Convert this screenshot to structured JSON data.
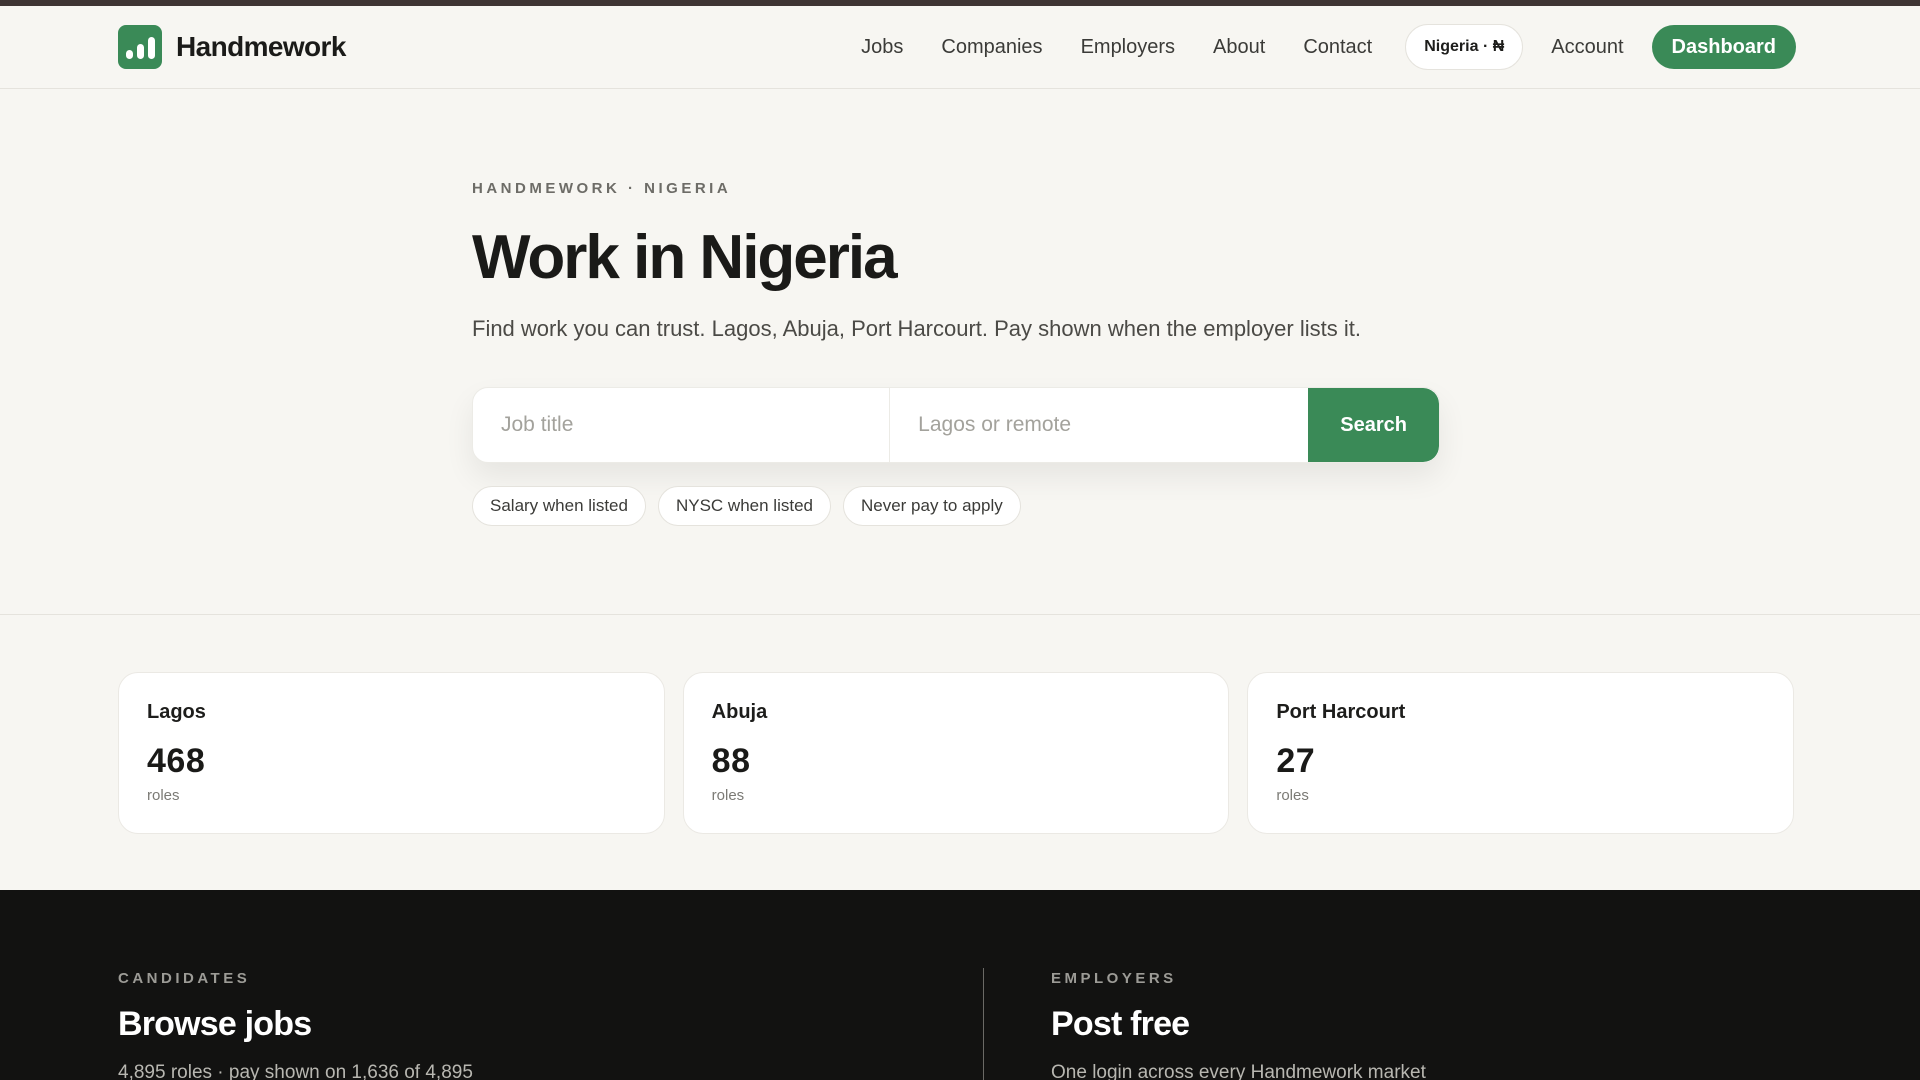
{
  "brand": {
    "name": "Handmework"
  },
  "nav": {
    "links": [
      "Jobs",
      "Companies",
      "Employers",
      "About",
      "Contact"
    ],
    "market_pill": "Nigeria · ₦",
    "account": "Account",
    "dashboard": "Dashboard"
  },
  "hero": {
    "eyebrow": "HANDMEWORK · NIGERIA",
    "title": "Work in Nigeria",
    "lede": "Find work you can trust. Lagos, Abuja, Port Harcourt. Pay shown when the employer lists it."
  },
  "search": {
    "title_placeholder": "Job title",
    "title_value": "",
    "location_placeholder": "Lagos or remote",
    "location_value": "",
    "button": "Search"
  },
  "chips": [
    "Salary when listed",
    "NYSC when listed",
    "Never pay to apply"
  ],
  "cities": [
    {
      "name": "Lagos",
      "count": "468",
      "unit": "roles"
    },
    {
      "name": "Abuja",
      "count": "88",
      "unit": "roles"
    },
    {
      "name": "Port Harcourt",
      "count": "27",
      "unit": "roles"
    }
  ],
  "footer": {
    "candidates": {
      "eyebrow": "CANDIDATES",
      "title": "Browse jobs",
      "text": "4,895 roles · pay shown on 1,636 of 4,895"
    },
    "employers": {
      "eyebrow": "EMPLOYERS",
      "title": "Post free",
      "text": "One login across every Handmework market"
    }
  },
  "colors": {
    "accent": "#3a8a57",
    "background": "#f7f6f2",
    "footer": "#121211"
  }
}
